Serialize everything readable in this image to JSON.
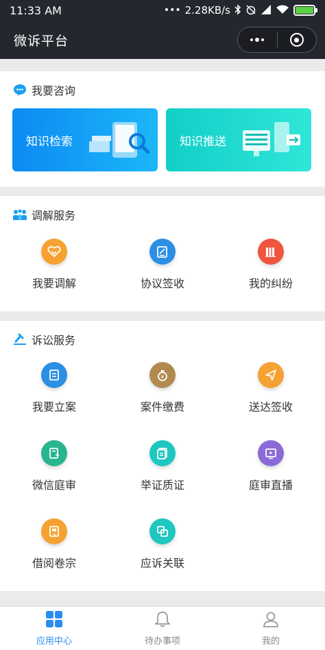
{
  "status_bar": {
    "time": "11:33 AM",
    "network_speed": "2.28KB/s",
    "icons": [
      "dots-icon",
      "bluetooth-icon",
      "alarm-off-icon",
      "signal-icon",
      "wifi-icon",
      "battery-charging-icon"
    ]
  },
  "navbar": {
    "title": "微诉平台"
  },
  "consult": {
    "title": "我要咨询",
    "cards": [
      {
        "label": "知识检索",
        "icon": "search-monitor-icon",
        "color": "#1a9ff5"
      },
      {
        "label": "知识推送",
        "icon": "push-monitor-icon",
        "color": "#1ed8cc"
      }
    ]
  },
  "mediation": {
    "title": "调解服务",
    "items": [
      {
        "label": "我要调解",
        "icon": "handshake-icon",
        "color": "#f5a233"
      },
      {
        "label": "协议签收",
        "icon": "sign-doc-icon",
        "color": "#2b8fe3"
      },
      {
        "label": "我的纠纷",
        "icon": "files-icon",
        "color": "#f0553f"
      }
    ]
  },
  "litigation": {
    "title": "诉讼服务",
    "items": [
      {
        "label": "我要立案",
        "icon": "file-case-icon",
        "color": "#2b8fe3"
      },
      {
        "label": "案件缴费",
        "icon": "money-bag-icon",
        "color": "#b18a4f"
      },
      {
        "label": "送达签收",
        "icon": "paper-plane-icon",
        "color": "#f5a233"
      },
      {
        "label": "微信庭审",
        "icon": "court-doc-icon",
        "color": "#28b58f"
      },
      {
        "label": "举证质证",
        "icon": "evidence-doc-icon",
        "color": "#1ec7c0"
      },
      {
        "label": "庭审直播",
        "icon": "live-play-icon",
        "color": "#8b6ad8"
      },
      {
        "label": "借阅卷宗",
        "icon": "archive-icon",
        "color": "#f5a233"
      },
      {
        "label": "应诉关联",
        "icon": "link-copy-icon",
        "color": "#1ec7c0"
      }
    ]
  },
  "tabbar": {
    "tabs": [
      {
        "label": "应用中心",
        "icon": "grid-apps-icon",
        "active": true
      },
      {
        "label": "待办事项",
        "icon": "bell-icon",
        "active": false
      },
      {
        "label": "我的",
        "icon": "user-icon",
        "active": false
      }
    ],
    "active_color": "#2a8cf0"
  }
}
